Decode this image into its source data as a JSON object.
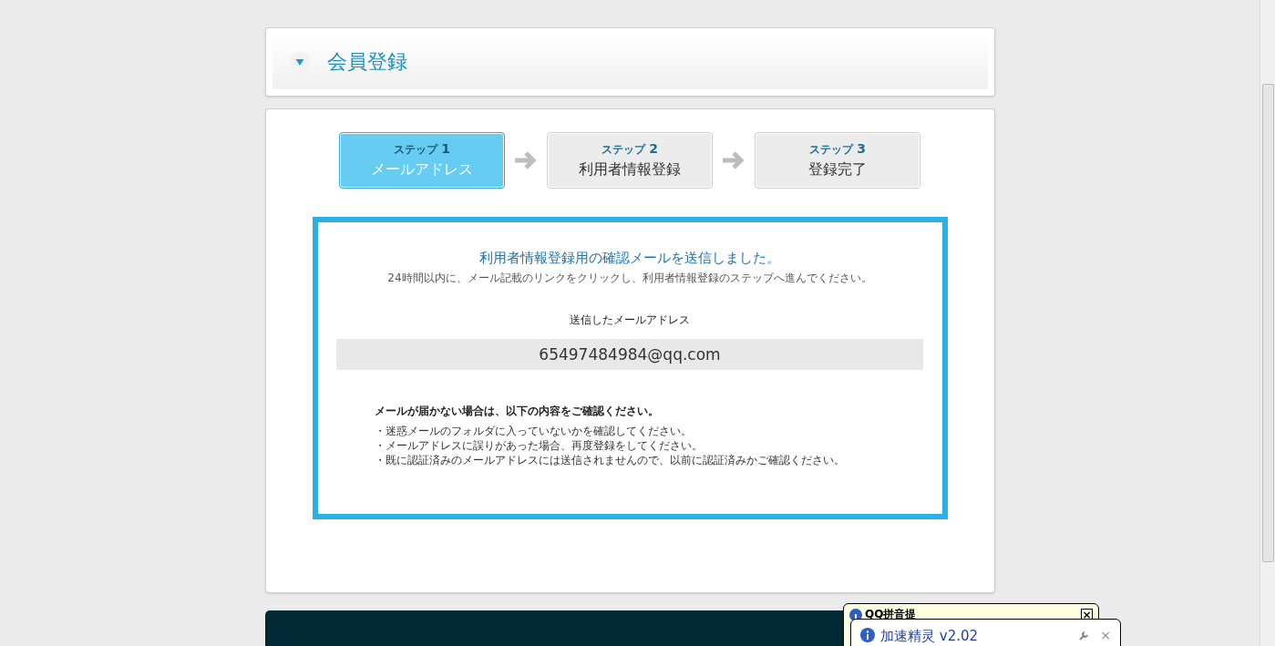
{
  "header": {
    "title": "会員登録"
  },
  "steps": [
    {
      "label": "ステップ",
      "number": "1",
      "name": "メールアドレス",
      "selected": true
    },
    {
      "label": "ステップ",
      "number": "2",
      "name": "利用者情報登録",
      "selected": false
    },
    {
      "label": "ステップ",
      "number": "3",
      "name": "登録完了",
      "selected": false
    }
  ],
  "notice": {
    "title": "利用者情報登録用の確認メールを送信しました。",
    "subtitle": "24時間以内に、メール記載のリンクをクリックし、利用者情報登録のステップへ進んでください。",
    "email_label": "送信したメールアドレス",
    "email": "65497484984@qq.com",
    "help_title": "メールが届かない場合は、以下の内容をご確認ください。",
    "help_items": [
      "・迷惑メールのフォルダに入っていないかを確認してください。",
      "・メールアドレスに誤りがあった場合、再度登録をしてください。",
      "・既に認証済みのメールアドレスには送信されませんので、以前に認証済みかご確認ください。"
    ]
  },
  "popups": [
    {
      "title": "QQ拼音提",
      "close": "×"
    },
    {
      "title": "加速精灵 v2.02",
      "close": "×"
    }
  ]
}
